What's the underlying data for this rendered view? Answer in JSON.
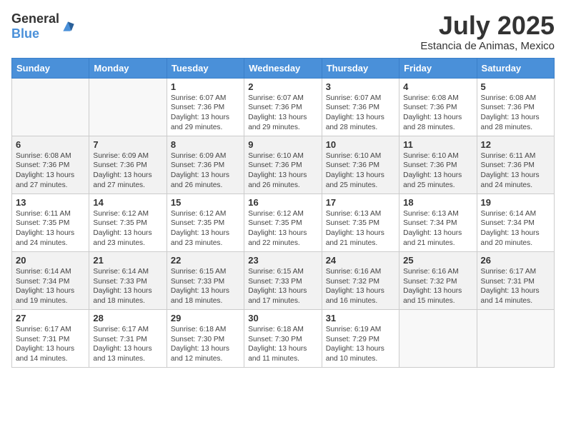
{
  "header": {
    "logo": {
      "general": "General",
      "blue": "Blue"
    },
    "title": "July 2025",
    "subtitle": "Estancia de Animas, Mexico"
  },
  "weekdays": [
    "Sunday",
    "Monday",
    "Tuesday",
    "Wednesday",
    "Thursday",
    "Friday",
    "Saturday"
  ],
  "weeks": [
    [
      {
        "day": "",
        "sunrise": "",
        "sunset": "",
        "daylight": ""
      },
      {
        "day": "",
        "sunrise": "",
        "sunset": "",
        "daylight": ""
      },
      {
        "day": "1",
        "sunrise": "Sunrise: 6:07 AM",
        "sunset": "Sunset: 7:36 PM",
        "daylight": "Daylight: 13 hours and 29 minutes."
      },
      {
        "day": "2",
        "sunrise": "Sunrise: 6:07 AM",
        "sunset": "Sunset: 7:36 PM",
        "daylight": "Daylight: 13 hours and 29 minutes."
      },
      {
        "day": "3",
        "sunrise": "Sunrise: 6:07 AM",
        "sunset": "Sunset: 7:36 PM",
        "daylight": "Daylight: 13 hours and 28 minutes."
      },
      {
        "day": "4",
        "sunrise": "Sunrise: 6:08 AM",
        "sunset": "Sunset: 7:36 PM",
        "daylight": "Daylight: 13 hours and 28 minutes."
      },
      {
        "day": "5",
        "sunrise": "Sunrise: 6:08 AM",
        "sunset": "Sunset: 7:36 PM",
        "daylight": "Daylight: 13 hours and 28 minutes."
      }
    ],
    [
      {
        "day": "6",
        "sunrise": "Sunrise: 6:08 AM",
        "sunset": "Sunset: 7:36 PM",
        "daylight": "Daylight: 13 hours and 27 minutes."
      },
      {
        "day": "7",
        "sunrise": "Sunrise: 6:09 AM",
        "sunset": "Sunset: 7:36 PM",
        "daylight": "Daylight: 13 hours and 27 minutes."
      },
      {
        "day": "8",
        "sunrise": "Sunrise: 6:09 AM",
        "sunset": "Sunset: 7:36 PM",
        "daylight": "Daylight: 13 hours and 26 minutes."
      },
      {
        "day": "9",
        "sunrise": "Sunrise: 6:10 AM",
        "sunset": "Sunset: 7:36 PM",
        "daylight": "Daylight: 13 hours and 26 minutes."
      },
      {
        "day": "10",
        "sunrise": "Sunrise: 6:10 AM",
        "sunset": "Sunset: 7:36 PM",
        "daylight": "Daylight: 13 hours and 25 minutes."
      },
      {
        "day": "11",
        "sunrise": "Sunrise: 6:10 AM",
        "sunset": "Sunset: 7:36 PM",
        "daylight": "Daylight: 13 hours and 25 minutes."
      },
      {
        "day": "12",
        "sunrise": "Sunrise: 6:11 AM",
        "sunset": "Sunset: 7:36 PM",
        "daylight": "Daylight: 13 hours and 24 minutes."
      }
    ],
    [
      {
        "day": "13",
        "sunrise": "Sunrise: 6:11 AM",
        "sunset": "Sunset: 7:35 PM",
        "daylight": "Daylight: 13 hours and 24 minutes."
      },
      {
        "day": "14",
        "sunrise": "Sunrise: 6:12 AM",
        "sunset": "Sunset: 7:35 PM",
        "daylight": "Daylight: 13 hours and 23 minutes."
      },
      {
        "day": "15",
        "sunrise": "Sunrise: 6:12 AM",
        "sunset": "Sunset: 7:35 PM",
        "daylight": "Daylight: 13 hours and 23 minutes."
      },
      {
        "day": "16",
        "sunrise": "Sunrise: 6:12 AM",
        "sunset": "Sunset: 7:35 PM",
        "daylight": "Daylight: 13 hours and 22 minutes."
      },
      {
        "day": "17",
        "sunrise": "Sunrise: 6:13 AM",
        "sunset": "Sunset: 7:35 PM",
        "daylight": "Daylight: 13 hours and 21 minutes."
      },
      {
        "day": "18",
        "sunrise": "Sunrise: 6:13 AM",
        "sunset": "Sunset: 7:34 PM",
        "daylight": "Daylight: 13 hours and 21 minutes."
      },
      {
        "day": "19",
        "sunrise": "Sunrise: 6:14 AM",
        "sunset": "Sunset: 7:34 PM",
        "daylight": "Daylight: 13 hours and 20 minutes."
      }
    ],
    [
      {
        "day": "20",
        "sunrise": "Sunrise: 6:14 AM",
        "sunset": "Sunset: 7:34 PM",
        "daylight": "Daylight: 13 hours and 19 minutes."
      },
      {
        "day": "21",
        "sunrise": "Sunrise: 6:14 AM",
        "sunset": "Sunset: 7:33 PM",
        "daylight": "Daylight: 13 hours and 18 minutes."
      },
      {
        "day": "22",
        "sunrise": "Sunrise: 6:15 AM",
        "sunset": "Sunset: 7:33 PM",
        "daylight": "Daylight: 13 hours and 18 minutes."
      },
      {
        "day": "23",
        "sunrise": "Sunrise: 6:15 AM",
        "sunset": "Sunset: 7:33 PM",
        "daylight": "Daylight: 13 hours and 17 minutes."
      },
      {
        "day": "24",
        "sunrise": "Sunrise: 6:16 AM",
        "sunset": "Sunset: 7:32 PM",
        "daylight": "Daylight: 13 hours and 16 minutes."
      },
      {
        "day": "25",
        "sunrise": "Sunrise: 6:16 AM",
        "sunset": "Sunset: 7:32 PM",
        "daylight": "Daylight: 13 hours and 15 minutes."
      },
      {
        "day": "26",
        "sunrise": "Sunrise: 6:17 AM",
        "sunset": "Sunset: 7:31 PM",
        "daylight": "Daylight: 13 hours and 14 minutes."
      }
    ],
    [
      {
        "day": "27",
        "sunrise": "Sunrise: 6:17 AM",
        "sunset": "Sunset: 7:31 PM",
        "daylight": "Daylight: 13 hours and 14 minutes."
      },
      {
        "day": "28",
        "sunrise": "Sunrise: 6:17 AM",
        "sunset": "Sunset: 7:31 PM",
        "daylight": "Daylight: 13 hours and 13 minutes."
      },
      {
        "day": "29",
        "sunrise": "Sunrise: 6:18 AM",
        "sunset": "Sunset: 7:30 PM",
        "daylight": "Daylight: 13 hours and 12 minutes."
      },
      {
        "day": "30",
        "sunrise": "Sunrise: 6:18 AM",
        "sunset": "Sunset: 7:30 PM",
        "daylight": "Daylight: 13 hours and 11 minutes."
      },
      {
        "day": "31",
        "sunrise": "Sunrise: 6:19 AM",
        "sunset": "Sunset: 7:29 PM",
        "daylight": "Daylight: 13 hours and 10 minutes."
      },
      {
        "day": "",
        "sunrise": "",
        "sunset": "",
        "daylight": ""
      },
      {
        "day": "",
        "sunrise": "",
        "sunset": "",
        "daylight": ""
      }
    ]
  ]
}
